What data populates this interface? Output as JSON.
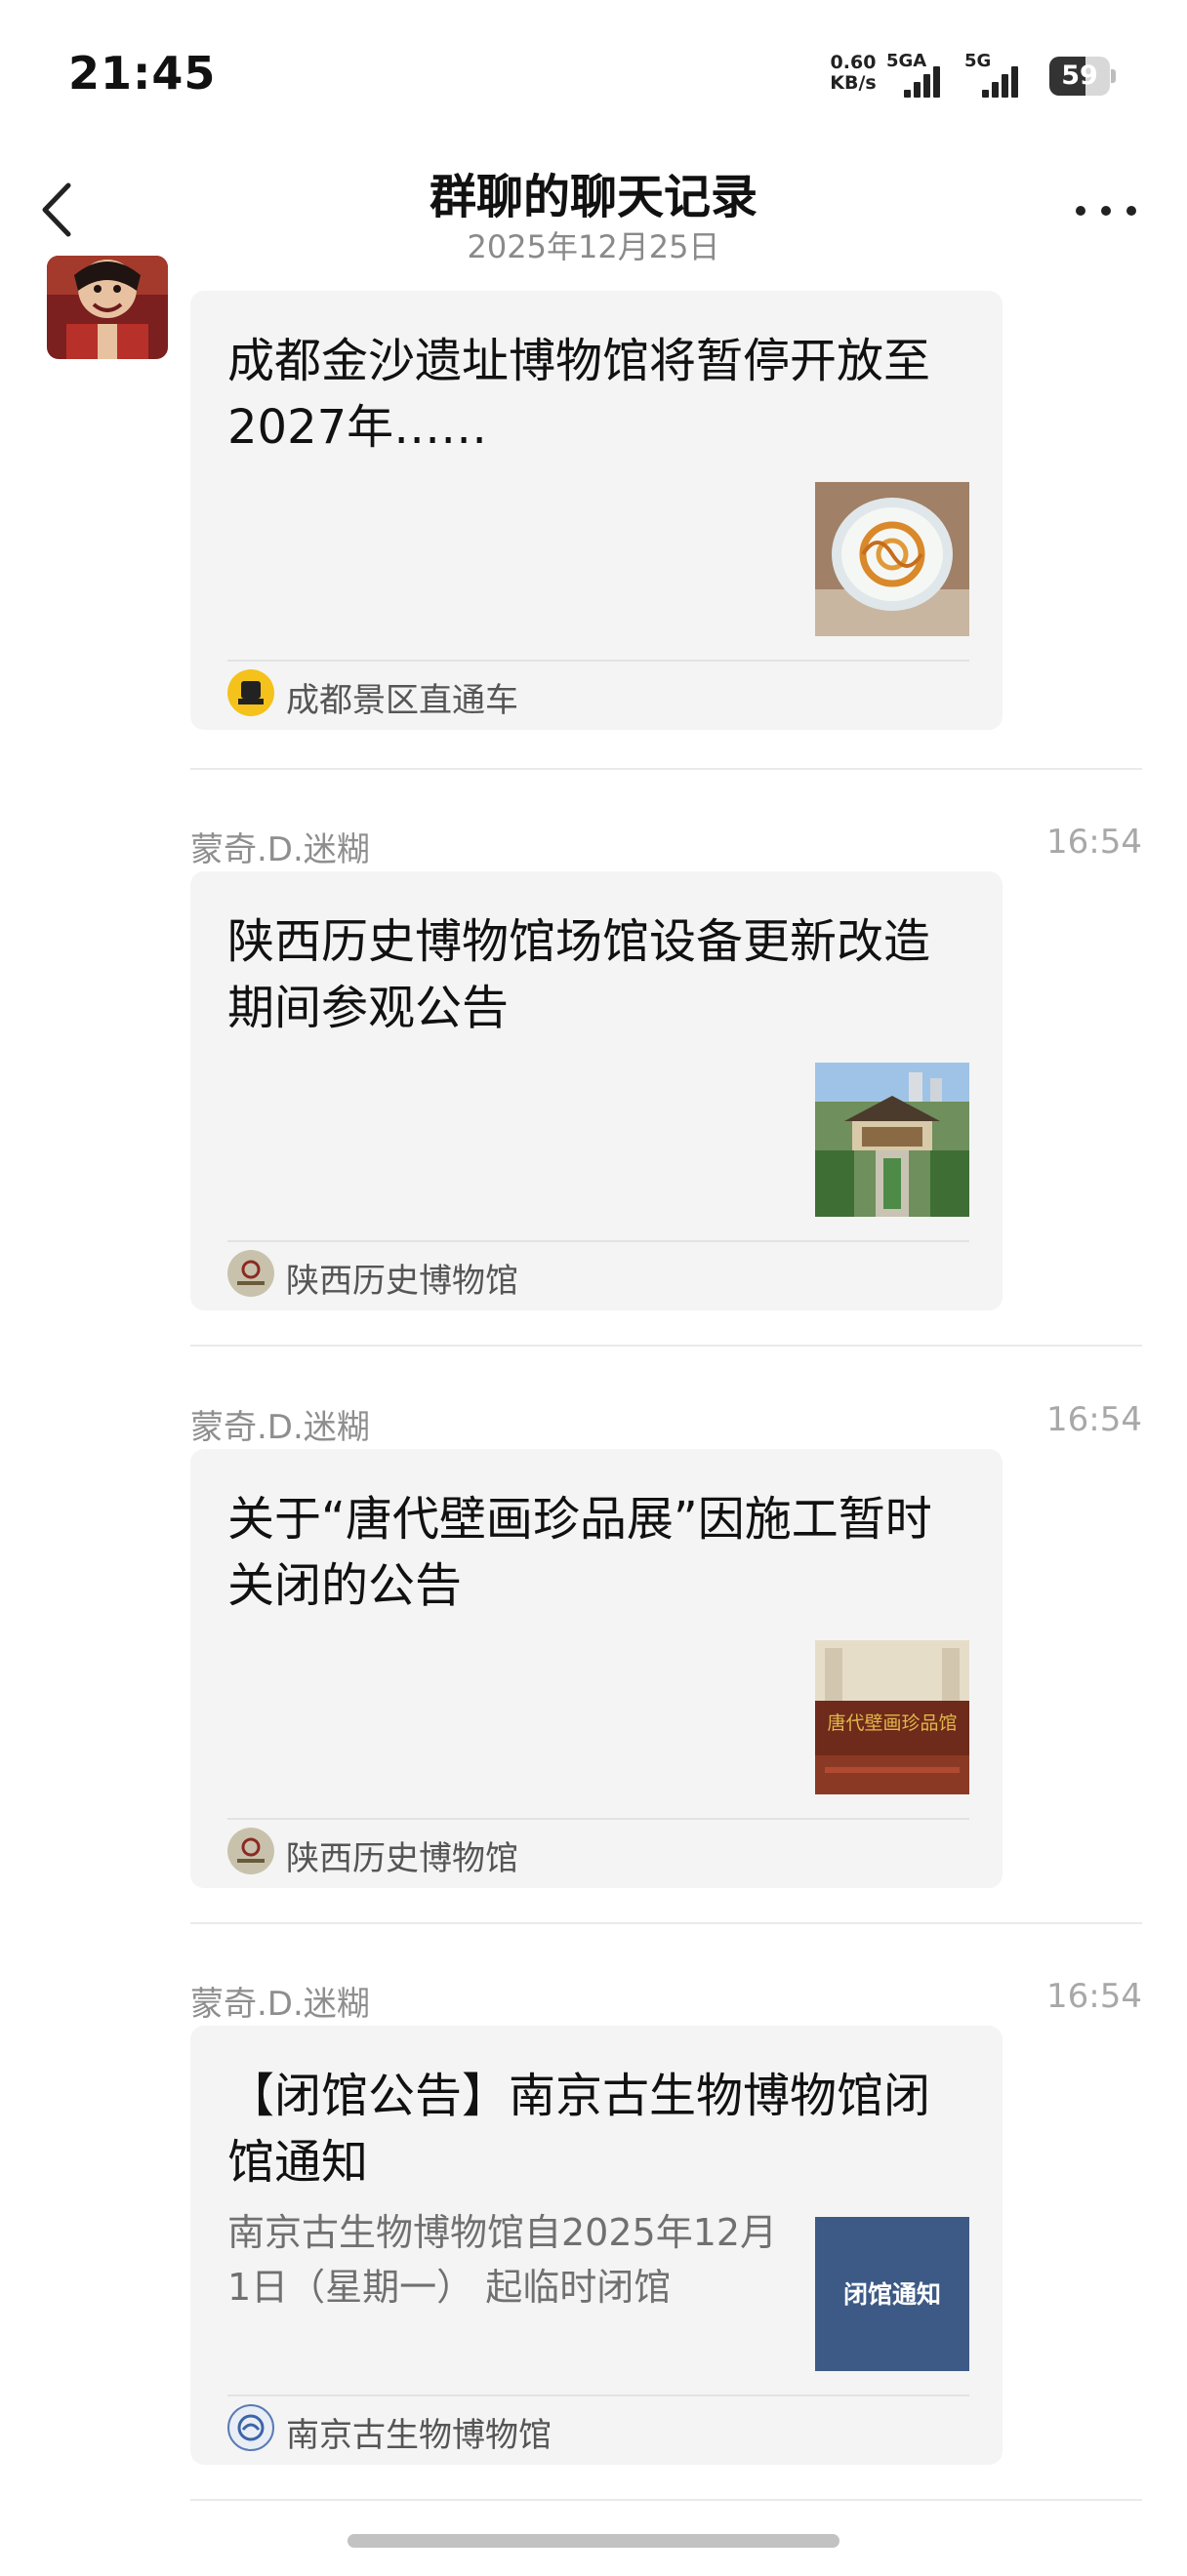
{
  "status_bar": {
    "time": "21:45",
    "net_speed_value": "0.60",
    "net_speed_unit": "KB/s",
    "signal_1_label": "5GA",
    "signal_2_label": "5G",
    "battery": "59",
    "battery_level": 0.59
  },
  "header": {
    "title": "群聊的聊天记录",
    "date": "2025年12月25日",
    "back_icon": "chevron-left-icon",
    "more_icon": "more-dots-icon"
  },
  "messages": [
    {
      "sender": "",
      "time": "",
      "title": "成都金沙遗址博物馆将暂停开放至2027年……",
      "description": "",
      "source": "成都景区直通车",
      "thumb_icon": "museum-dome-image"
    },
    {
      "sender": "蒙奇.D.迷糊",
      "time": "16:54",
      "title": "陕西历史博物馆场馆设备更新改造期间参观公告",
      "description": "",
      "source": "陕西历史博物馆",
      "thumb_icon": "museum-building-image"
    },
    {
      "sender": "蒙奇.D.迷糊",
      "time": "16:54",
      "title": "关于“唐代壁画珍品展”因施工暂时关闭的公告",
      "description": "",
      "source": "陕西历史博物馆",
      "thumb_icon": "mural-hall-image",
      "thumb_text": "唐代壁画珍品馆"
    },
    {
      "sender": "蒙奇.D.迷糊",
      "time": "16:54",
      "title": "【闭馆公告】南京古生物博物馆闭馆通知",
      "description": "南京古生物博物馆自2025年12月1日（星期一） 起临时闭馆",
      "source": "南京古生物博物馆",
      "thumb_icon": "notice-image",
      "thumb_text": "闭馆通知"
    }
  ],
  "colors": {
    "card_bg": "#f4f4f4",
    "sender_text": "#8e8e8e",
    "notice_thumb_bg": "#3d5a86"
  }
}
